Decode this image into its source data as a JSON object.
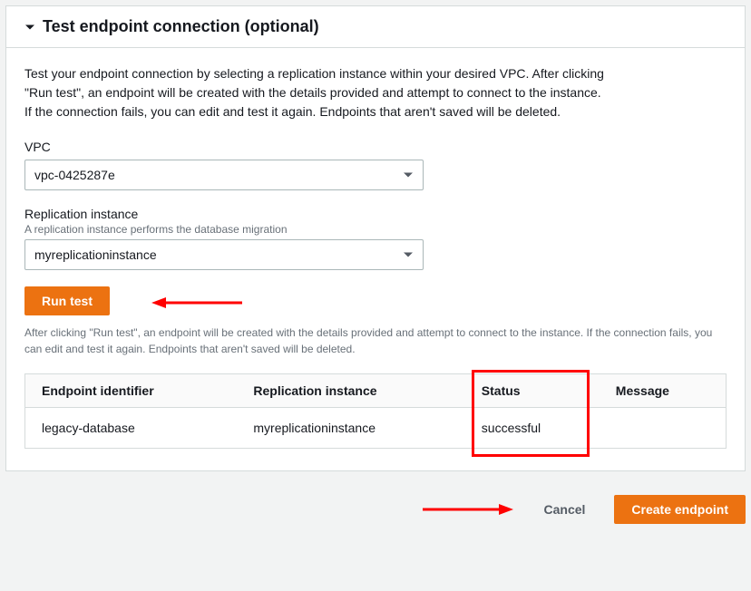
{
  "panel": {
    "title": "Test endpoint connection (optional)",
    "description": "Test your endpoint connection by selecting a replication instance within your desired VPC. After clicking \"Run test\", an endpoint will be created with the details provided and attempt to connect to the instance. If the connection fails, you can edit and test it again. Endpoints that aren't saved will be deleted."
  },
  "vpc": {
    "label": "VPC",
    "value": "vpc-0425287e"
  },
  "replication": {
    "label": "Replication instance",
    "helper": "A replication instance performs the database migration",
    "value": "myreplicationinstance"
  },
  "runTest": {
    "label": "Run test",
    "helper": "After clicking \"Run test\", an endpoint will be created with the details provided and attempt to connect to the instance. If the connection fails, you can edit and test it again. Endpoints that aren't saved will be deleted."
  },
  "table": {
    "headers": {
      "endpoint": "Endpoint identifier",
      "instance": "Replication instance",
      "status": "Status",
      "message": "Message"
    },
    "row": {
      "endpoint": "legacy-database",
      "instance": "myreplicationinstance",
      "status": "successful",
      "message": ""
    }
  },
  "footer": {
    "cancel": "Cancel",
    "create": "Create endpoint"
  }
}
